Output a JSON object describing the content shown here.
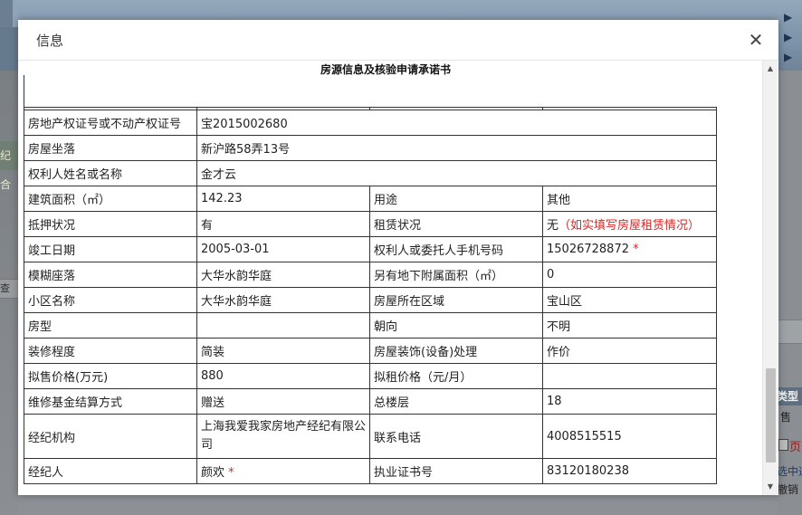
{
  "dialog": {
    "title": "信息",
    "close_glyph": "✕"
  },
  "document": {
    "title": "房源信息及核验申请承诺书"
  },
  "background": {
    "left_tab_text": "纪合",
    "left_button_text": "查询",
    "right_header_text": "类型",
    "right_text_1": "售",
    "right_text_2": "页",
    "right_link_text": "选中通",
    "right_text_3": "撤销"
  },
  "rows": {
    "cert_no": {
      "label": "房地产权证号或不动产权证号",
      "value": "宝2015002680"
    },
    "address": {
      "label": "房屋坐落",
      "value": "新沪路58弄13号"
    },
    "owner": {
      "label": "权利人姓名或名称",
      "value": "金才云"
    },
    "area": {
      "label": "建筑面积（㎡）",
      "value": "142.23",
      "label2": "用途",
      "value2": "其他"
    },
    "mortgage": {
      "label": "抵押状况",
      "value": "有",
      "label2": "租赁状况",
      "value2": "无",
      "note2": "（如实填写房屋租赁情况）"
    },
    "completion": {
      "label": "竣工日期",
      "value": "2005-03-01",
      "label2": "权利人或委托人手机号码",
      "value2": "15026728872",
      "star": "*"
    },
    "fuzzy": {
      "label": "模糊座落",
      "value": "大华水韵华庭",
      "label2": "另有地下附属面积（㎡）",
      "value2": "0"
    },
    "community": {
      "label": "小区名称",
      "value": "大华水韵华庭",
      "label2": "房屋所在区域",
      "value2": "宝山区"
    },
    "layout": {
      "label": "房型",
      "value": "",
      "label2": "朝向",
      "value2": "不明"
    },
    "decoration": {
      "label": "装修程度",
      "value": "简装",
      "label2": "房屋装饰(设备)处理",
      "value2": "作价"
    },
    "price": {
      "label": "拟售价格(万元)",
      "value": "880",
      "label2": "拟租价格（元/月）",
      "value2": ""
    },
    "fund": {
      "label": "维修基金结算方式",
      "value": "赠送",
      "label2": "总楼层",
      "value2": "18"
    },
    "agency": {
      "label": "经纪机构",
      "value": "上海我爱我家房地产经纪有限公司",
      "label2": "联系电话",
      "value2": "4008515515"
    },
    "agent": {
      "label": "经纪人",
      "value": "颜欢",
      "star": "*",
      "label2": "执业证书号",
      "value2": "83120180238"
    }
  },
  "colors": {
    "required_star": "#d42a2a",
    "border": "#333333",
    "overlay": "#8a8f95"
  }
}
